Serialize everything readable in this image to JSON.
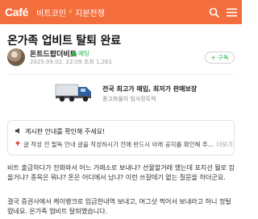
{
  "topbar": {
    "logo": "Café",
    "cafe_name_part1": "비트코인",
    "cafe_name_part2": "지분전쟁",
    "icons": [
      "bolt-icon",
      "search-icon",
      "menu-icon"
    ],
    "color": "#f46d3d"
  },
  "post": {
    "title": "온가족 업비트 탈퇴 완료",
    "author": "돈트드랍더비트",
    "grade": "예팅",
    "meta": "2025.09.02. 22:09  조회 1,261",
    "follow_label": "+ 구독"
  },
  "ad": {
    "title": "전국 최고가 매입, 최저가 판매보장",
    "subtitle": "중고화물차 임사장트럭"
  },
  "notice": {
    "title": "게시판 안내를 확인해 주세요!",
    "body": "글 작성 전 필독 안내 글을 작성하시기 전에 반드시 아래 공지를 확인해 주…",
    "more_label": "더보기"
  },
  "content": {
    "paragraph1": [
      "비트 출금하다가 전화와서 어느 거래소로 보내냐? 선물할거래 했는데 포지션 뭘로 잡",
      "을거냐? 종목은 뭐냐? 돈은 어디에서 났냐? 이런 쓰잘데기 없는 질문을 하더군요."
    ],
    "paragraph2": [
      "결국 증권사에서 케이뱅크로 입금한내역 보내고, 머그샷 찍어서 보내라고 하니 정털",
      "렸네요. 온가족 업비트 탈퇴했습니다."
    ]
  }
}
